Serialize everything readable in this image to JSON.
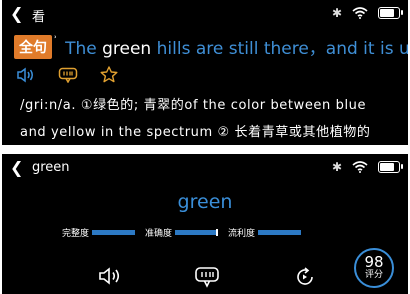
{
  "panel1": {
    "back_label": "看",
    "badge": "全句",
    "sentence_before": "The ",
    "sentence_highlight": "green",
    "sentence_after": " hills are still there，and it is u",
    "definition_line1": "/gri:n/a. ①绿色的; 青翠的of the color between blue",
    "definition_line2": "and yellow in the spectrum ② 长着青草或其他植物的",
    "icons": [
      "speaker-icon",
      "translate-bubble-icon",
      "star-icon"
    ]
  },
  "panel2": {
    "back_label": "green",
    "word": "green",
    "scores": [
      {
        "label": "完整度",
        "value": 1.0
      },
      {
        "label": "准确度",
        "value": 0.95
      },
      {
        "label": "流利度",
        "value": 1.0
      }
    ],
    "rating_value": "98",
    "rating_label": "评分",
    "icons": [
      "speaker-icon",
      "translate-bubble-icon",
      "replay-icon"
    ]
  },
  "colors": {
    "accent_blue": "#3a8ed8",
    "badge_orange": "#e07b2a",
    "background": "#000000"
  }
}
